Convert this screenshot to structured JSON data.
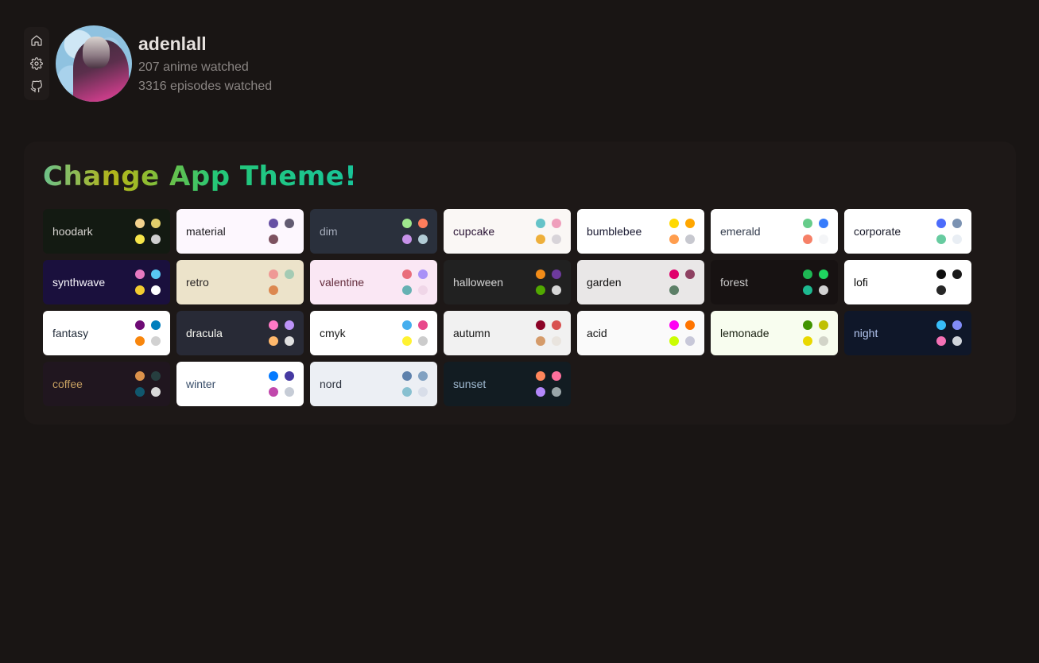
{
  "sidebar": {
    "items": [
      {
        "name": "home-icon"
      },
      {
        "name": "gear-icon"
      },
      {
        "name": "github-icon"
      }
    ]
  },
  "profile": {
    "username": "adenlall",
    "anime_watched": "207 anime watched",
    "episodes_watched": "3316 episodes watched"
  },
  "theme_panel": {
    "title_parts": [
      {
        "text": "Change",
        "color": "#8dbd4a"
      },
      {
        "text": " ",
        "color": "#8dbd4a"
      },
      {
        "text": "App Theme!",
        "color": "#20c48a"
      }
    ],
    "title": "Change App Theme!",
    "themes": [
      {
        "label": "hoodark",
        "bg": "#131a12",
        "fg": "#d6d3cf",
        "dots": [
          "#f3d28e",
          "#e2cf6b",
          "#f6e54a",
          "#cfcfcf"
        ]
      },
      {
        "label": "material",
        "bg": "#fdf7fe",
        "fg": "#1d1b20",
        "dots": [
          "#6750a4",
          "#625b71",
          "#7d5260",
          "#fdf7fe"
        ]
      },
      {
        "label": "dim",
        "bg": "#2a303c",
        "fg": "#a6adbb",
        "dots": [
          "#9fe88d",
          "#ff7d5c",
          "#c792e9",
          "#b2ccd6"
        ]
      },
      {
        "label": "cupcake",
        "bg": "#faf7f5",
        "fg": "#291334",
        "dots": [
          "#65c3c8",
          "#ef9fbc",
          "#eeaf3a",
          "#d8d4d9"
        ]
      },
      {
        "label": "bumblebee",
        "bg": "#ffffff",
        "fg": "#181830",
        "dots": [
          "#ffd900",
          "#ffa600",
          "#ff9d4d",
          "#c7c8cf"
        ]
      },
      {
        "label": "emerald",
        "bg": "#ffffff",
        "fg": "#333c4d",
        "dots": [
          "#66cc8a",
          "#377cfb",
          "#f68067",
          "#f4f5f7"
        ]
      },
      {
        "label": "corporate",
        "bg": "#ffffff",
        "fg": "#181a2a",
        "dots": [
          "#4b6bfb",
          "#7b92b2",
          "#67cba0",
          "#e9eef4"
        ]
      },
      {
        "label": "synthwave",
        "bg": "#1a103d",
        "fg": "#f9f7fd",
        "dots": [
          "#e779c1",
          "#58c7f3",
          "#f3cc30",
          "#ffffff"
        ]
      },
      {
        "label": "retro",
        "bg": "#ece3ca",
        "fg": "#282425",
        "dots": [
          "#ef9995",
          "#a4cbb4",
          "#dc8850",
          "#ece3ca"
        ]
      },
      {
        "label": "valentine",
        "bg": "#fae7f4",
        "fg": "#632c3b",
        "dots": [
          "#e96d7b",
          "#a991f7",
          "#66b1b3",
          "#f0d6e8"
        ]
      },
      {
        "label": "halloween",
        "bg": "#212121",
        "fg": "#d6d6d6",
        "dots": [
          "#f28c18",
          "#6d3a9c",
          "#51a800",
          "#d6d6d6"
        ]
      },
      {
        "label": "garden",
        "bg": "#e9e7e7",
        "fg": "#100f0f",
        "dots": [
          "#e0006c",
          "#8e4162",
          "#5c7f67",
          "#e9e7e7"
        ]
      },
      {
        "label": "forest",
        "bg": "#171212",
        "fg": "#cac9c9",
        "dots": [
          "#1eb854",
          "#1fd65f",
          "#1db990",
          "#d2d2d2"
        ]
      },
      {
        "label": "lofi",
        "bg": "#ffffff",
        "fg": "#000000",
        "dots": [
          "#0d0d0d",
          "#1a1919",
          "#262626",
          "#ffffff"
        ]
      },
      {
        "label": "fantasy",
        "bg": "#ffffff",
        "fg": "#1f2937",
        "dots": [
          "#6e0b75",
          "#007ebd",
          "#f8860d",
          "#d1d1d1"
        ]
      },
      {
        "label": "dracula",
        "bg": "#282a36",
        "fg": "#f8f8f2",
        "dots": [
          "#ff79c6",
          "#bd93f9",
          "#ffb86c",
          "#e0e0e0"
        ]
      },
      {
        "label": "cmyk",
        "bg": "#ffffff",
        "fg": "#1a1a1a",
        "dots": [
          "#45aeee",
          "#e8488a",
          "#fff232",
          "#cccccc"
        ]
      },
      {
        "label": "autumn",
        "bg": "#f1f1f1",
        "fg": "#141414",
        "dots": [
          "#8c0327",
          "#d85251",
          "#d59b6a",
          "#e9e4de"
        ]
      },
      {
        "label": "acid",
        "bg": "#fafafa",
        "fg": "#141414",
        "dots": [
          "#ff00f4",
          "#ff7400",
          "#cbfd03",
          "#c8c8d9"
        ]
      },
      {
        "label": "lemonade",
        "bg": "#f8fdef",
        "fg": "#181f10",
        "dots": [
          "#419400",
          "#bfc000",
          "#e9d800",
          "#d2d4c8"
        ]
      },
      {
        "label": "night",
        "bg": "#0f1729",
        "fg": "#b3c5ef",
        "dots": [
          "#38bdf8",
          "#818cf8",
          "#f471b5",
          "#d1d5db"
        ]
      },
      {
        "label": "coffee",
        "bg": "#20161f",
        "fg": "#c59f60",
        "dots": [
          "#db924b",
          "#263e3f",
          "#10576d",
          "#d9d9d9"
        ]
      },
      {
        "label": "winter",
        "bg": "#ffffff",
        "fg": "#394e6a",
        "dots": [
          "#047aff",
          "#463aa2",
          "#c148ac",
          "#c6ccd6"
        ]
      },
      {
        "label": "nord",
        "bg": "#eceff4",
        "fg": "#2e3440",
        "dots": [
          "#5e81ac",
          "#81a1c1",
          "#88c0d0",
          "#d8dee9"
        ]
      },
      {
        "label": "sunset",
        "bg": "#121c22",
        "fg": "#9fb9d0",
        "dots": [
          "#ff865b",
          "#fd6f9c",
          "#b387fa",
          "#9aa5a8"
        ]
      }
    ]
  }
}
